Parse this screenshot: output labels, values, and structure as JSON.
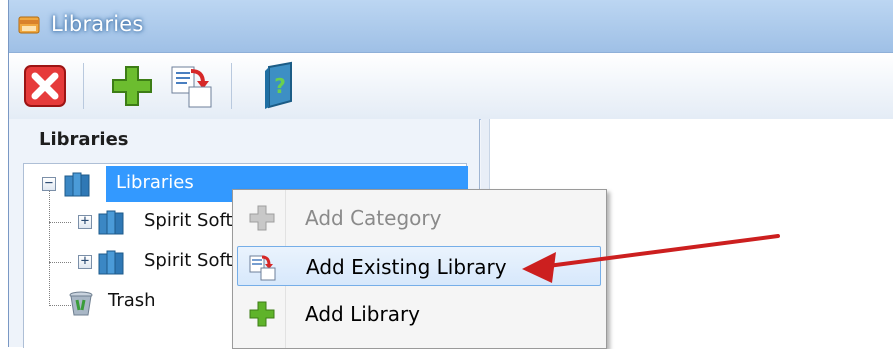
{
  "window": {
    "title": "Libraries"
  },
  "toolbar": {
    "buttons": [
      {
        "icon": "close-icon"
      },
      {
        "icon": "add-icon"
      },
      {
        "icon": "add-existing-icon"
      },
      {
        "icon": "help-book-icon"
      }
    ]
  },
  "panel": {
    "header": "Libraries",
    "tree": {
      "root": {
        "label": "Libraries",
        "expanded": true,
        "selected": true
      },
      "children": [
        {
          "label": "Spirit Soft",
          "expanded": false
        },
        {
          "label": "Spirit Soft",
          "expanded": false
        },
        {
          "label": "Trash"
        }
      ]
    }
  },
  "context_menu": {
    "items": [
      {
        "label": "Add Category",
        "icon": "gray-plus-icon",
        "disabled": true
      },
      {
        "label": "Add Existing Library",
        "icon": "add-existing-icon",
        "highlighted": true
      },
      {
        "label": "Add Library",
        "icon": "green-plus-icon"
      }
    ]
  },
  "colors": {
    "selection": "#3399ff",
    "accent_red": "#cc1f1f",
    "plus_green": "#5fb32a",
    "titlebar": "#a9c8ec"
  }
}
